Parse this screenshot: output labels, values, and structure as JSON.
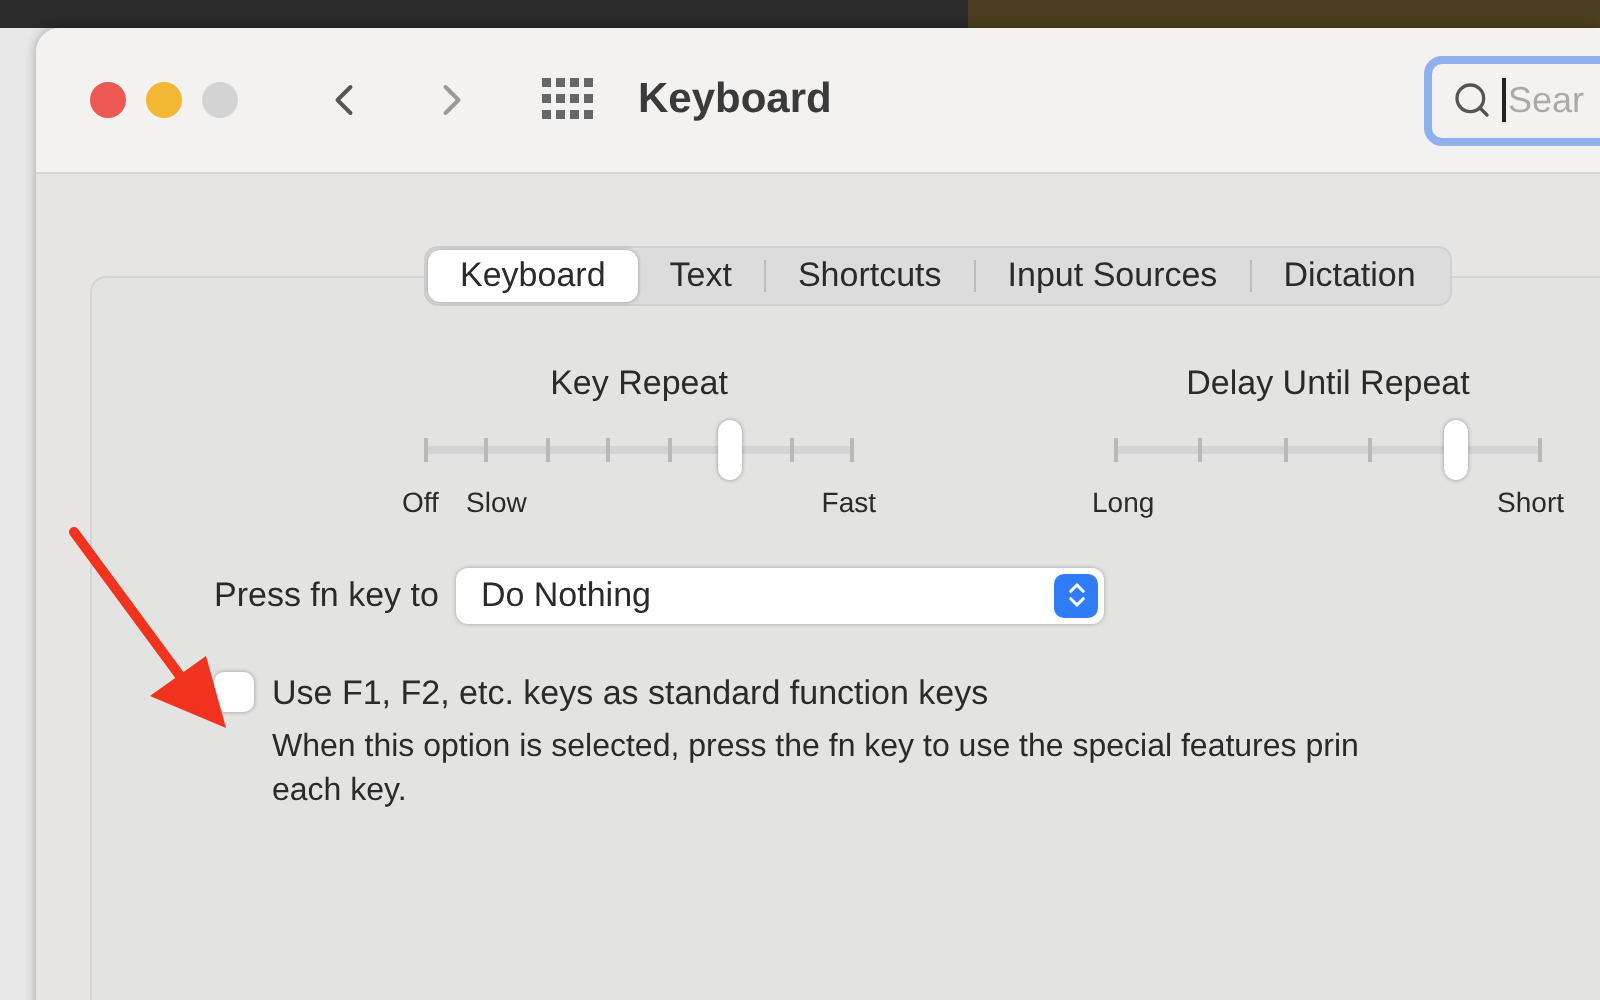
{
  "window": {
    "title": "Keyboard"
  },
  "search": {
    "placeholder": "Sear"
  },
  "tabs": [
    {
      "label": "Keyboard",
      "selected": true
    },
    {
      "label": "Text",
      "selected": false
    },
    {
      "label": "Shortcuts",
      "selected": false
    },
    {
      "label": "Input Sources",
      "selected": false
    },
    {
      "label": "Dictation",
      "selected": false
    }
  ],
  "sliders": [
    {
      "title": "Key Repeat",
      "level": 0.714,
      "labels": [
        "Off",
        "Slow",
        "Fast"
      ]
    },
    {
      "title": "Delay Until Repeat",
      "level": 0.8,
      "labels": [
        "Long",
        "Short"
      ]
    }
  ],
  "fn_key": {
    "label": "Press fn key to",
    "value": "Do Nothing"
  },
  "function_keys": {
    "label": "Use F1, F2, etc. keys as standard function keys",
    "checked": false,
    "description": [
      "When this option is selected, press the fn key to use the special features prin",
      "each key."
    ]
  }
}
